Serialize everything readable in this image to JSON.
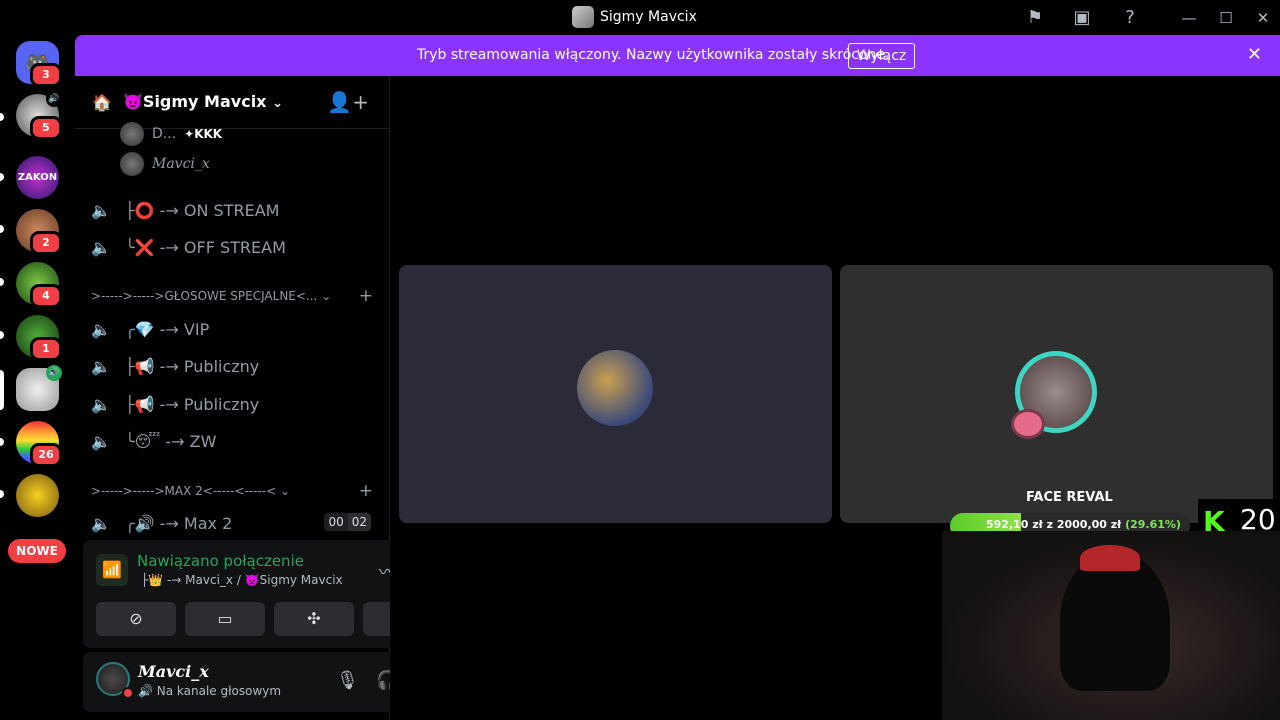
{
  "window": {
    "title": "Sigmy Mavcix",
    "icons": [
      "flag-icon",
      "inbox-icon",
      "help-icon"
    ],
    "controls": [
      "minimize",
      "maximize",
      "close"
    ]
  },
  "rail": {
    "servers": [
      {
        "name": "discord-home",
        "badge": "3",
        "color": "#5865f2"
      },
      {
        "name": "server-2",
        "badge": "5",
        "speaker": true
      },
      {
        "name": "zakon",
        "label": "ZAKON"
      },
      {
        "name": "server-4",
        "badge": "2"
      },
      {
        "name": "server-5",
        "badge": "4"
      },
      {
        "name": "server-6",
        "badge": "1"
      },
      {
        "name": "server-7",
        "voice": true
      },
      {
        "name": "server-8",
        "badge": "26"
      },
      {
        "name": "server-9"
      }
    ],
    "new_label": "NOWE"
  },
  "banner": {
    "text": "Tryb streamowania włączony. Nazwy użytkownika zostały skrócone.",
    "button": "Wyłącz",
    "color": "#8c34ff"
  },
  "server": {
    "name": "👿Sigmy Mavcix",
    "chevron": "⌄"
  },
  "members": [
    {
      "name": "D...",
      "tag": "✦KKK"
    },
    {
      "name": "Mavci_x"
    }
  ],
  "channels": [
    {
      "label": "├⭕ -→ ON STREAM"
    },
    {
      "label": "╰❌ -→ OFF STREAM"
    }
  ],
  "category1": {
    "label": ">----->----->GŁOSOWE SPECJALNE<..."
  },
  "channels2": [
    {
      "label": "╭💎 -→ VIP"
    },
    {
      "label": "├📢 -→ Publiczny"
    },
    {
      "label": "├📢 -→ Publiczny"
    },
    {
      "label": "╰😴 -→ ZW"
    }
  ],
  "category2": {
    "label": ">----->----->MAX 2<-----<-----<"
  },
  "channel_max2": {
    "label": "╭🔊 -→ Max 2",
    "count_current": "00",
    "count_limit": "02"
  },
  "voice_panel": {
    "status": "Nawiązano połączenie",
    "subtitle": "├👑 -→ Mavci_x / 👿Sigmy Mavcix",
    "accent": "#23a55a"
  },
  "user_panel": {
    "name": "Mavci_x",
    "status": "Na kanale głosowym"
  },
  "overlay": {
    "title": "FACE REVAL",
    "goal_text": "592,10 zł z 2000,00 zł",
    "goal_pct": "(29.61%)",
    "goal_fraction": 0.2961,
    "viewer_count": "20",
    "kick_color": "#53fc18"
  }
}
